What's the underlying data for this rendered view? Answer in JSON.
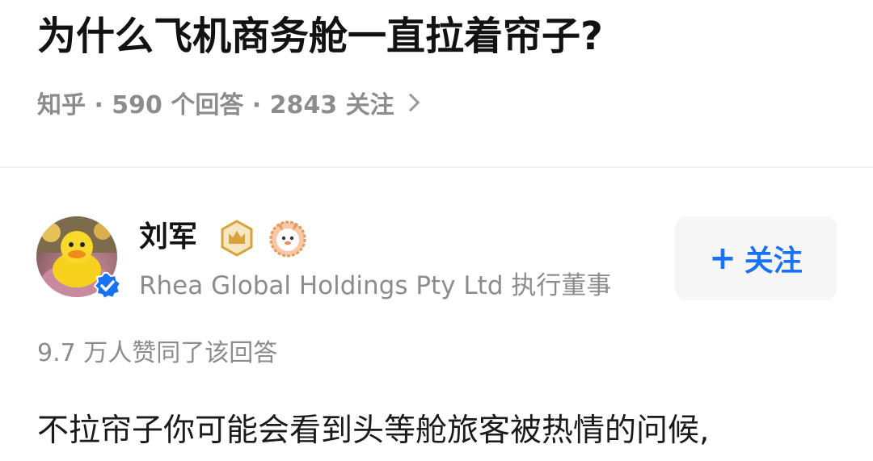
{
  "question": {
    "title": "为什么飞机商务舱一直拉着帘子?",
    "meta": "知乎 · 590 个回答 · 2843 关注"
  },
  "answer": {
    "author": {
      "name": "刘军",
      "bio": "Rhea Global Holdings Pty Ltd 执行董事",
      "avatar_icon": "yellow-duck-avatar",
      "verified_icon": "verified-check-icon",
      "badges": [
        "crown-badge-icon",
        "mascot-badge-icon"
      ]
    },
    "follow_button": {
      "plus": "+",
      "label": "关注"
    },
    "likes_text": "9.7 万人赞同了该回答",
    "content_first_line": "不拉帘子你可能会看到头等舱旅客被热情的问候,"
  },
  "colors": {
    "accent": "#1772f6",
    "muted_text": "#8c8c8c",
    "title_text": "#121212",
    "badge_gold": "#d9a23b"
  }
}
